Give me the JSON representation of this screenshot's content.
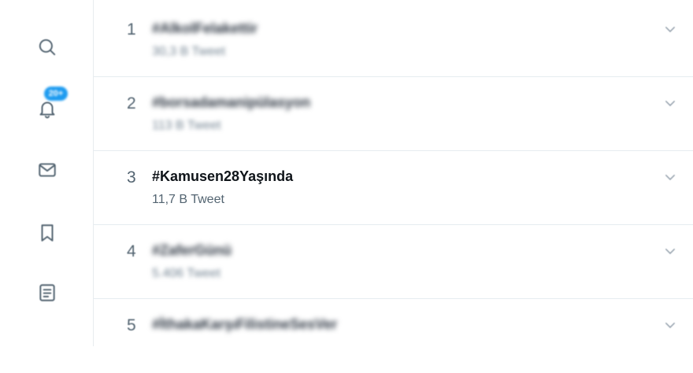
{
  "sidebar": {
    "items": [
      {
        "icon": "search-icon"
      },
      {
        "icon": "bell-icon",
        "badge": "20+"
      },
      {
        "icon": "mail-icon"
      },
      {
        "icon": "bookmark-icon"
      },
      {
        "icon": "list-icon"
      }
    ],
    "badge_color": "#1d9bf0"
  },
  "trends": [
    {
      "rank": "1",
      "tag": "#AlkolFelakettir",
      "count": "30,3 B Tweet"
    },
    {
      "rank": "2",
      "tag": "#borsadamanipülasyon",
      "count": "113 B Tweet"
    },
    {
      "rank": "3",
      "tag": "#Kamusen28Yaşında",
      "count": "11,7 B Tweet"
    },
    {
      "rank": "4",
      "tag": "#ZaferGünü",
      "count": "5.406 Tweet"
    },
    {
      "rank": "5",
      "tag": "#İthakaKarşıFilistineSesVer",
      "count": ""
    }
  ],
  "colors": {
    "text_primary": "#0f1419",
    "text_secondary": "#536471",
    "divider": "#e6ecf0",
    "accent": "#1d9bf0"
  }
}
